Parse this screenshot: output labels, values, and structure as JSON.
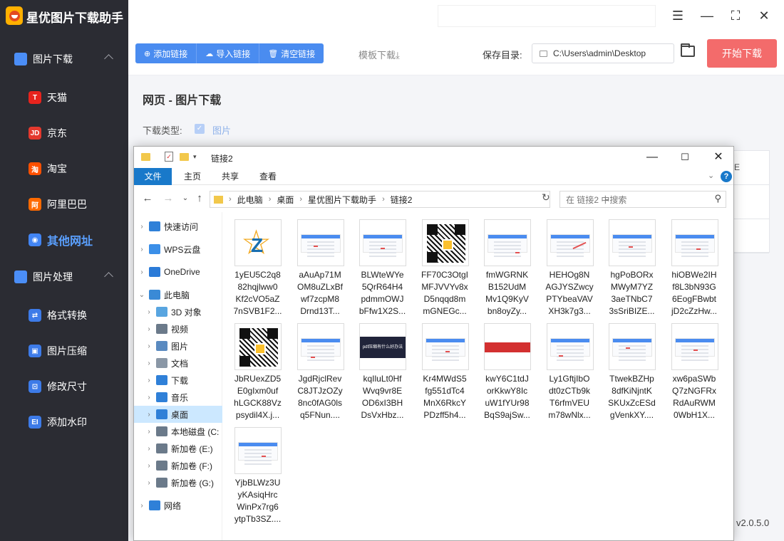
{
  "app": {
    "title": "星优图片下载助手",
    "version": "v2.0.5.0"
  },
  "sidebar": {
    "sections": [
      {
        "label": "图片下载",
        "items": [
          {
            "label": "天猫",
            "icon": "T",
            "color": "#e8231d"
          },
          {
            "label": "京东",
            "icon": "JD",
            "color": "#e4392e"
          },
          {
            "label": "淘宝",
            "icon": "淘",
            "color": "#ff5000"
          },
          {
            "label": "阿里巴巴",
            "icon": "阿",
            "color": "#ff6a00"
          },
          {
            "label": "其他网址",
            "icon": "◉",
            "color": "#4285f4",
            "active": true
          }
        ]
      },
      {
        "label": "图片处理",
        "items": [
          {
            "label": "格式转换",
            "icon": "⇄",
            "color": "#3d7be8"
          },
          {
            "label": "图片压缩",
            "icon": "▣",
            "color": "#3d7be8"
          },
          {
            "label": "修改尺寸",
            "icon": "⊡",
            "color": "#3d7be8"
          },
          {
            "label": "添加水印",
            "icon": "EI",
            "color": "#3d7be8"
          }
        ]
      }
    ]
  },
  "toolbar": {
    "add_link": "添加链接",
    "import_link": "导入链接",
    "clear_link": "清空链接",
    "template_download": "模板下载⤓",
    "save_dir_label": "保存目录:",
    "save_dir_value": "C:\\Users\\admin\\Desktop",
    "start_button": "开始下载"
  },
  "main": {
    "page_title": "网页 - 图片下载",
    "download_type_label": "下载类型:",
    "download_type_value": "图片",
    "table_header_fragment": "E"
  },
  "explorer": {
    "title": "链接2",
    "ribbon_tabs": [
      "文件",
      "主页",
      "共享",
      "查看"
    ],
    "breadcrumb": [
      "此电脑",
      "桌面",
      "星优图片下载助手",
      "链接2"
    ],
    "search_placeholder": "在 链接2 中搜索",
    "nav_items": [
      {
        "label": "快速访问",
        "icon": "star",
        "color": "#2f80d8",
        "level": 0,
        "arrow": "›"
      },
      {
        "label": "WPS云盘",
        "icon": "cloud",
        "color": "#3b8fe8",
        "level": 0,
        "arrow": "›"
      },
      {
        "label": "OneDrive",
        "icon": "cloud",
        "color": "#2b7bd8",
        "level": 0,
        "arrow": "›"
      },
      {
        "label": "此电脑",
        "icon": "pc",
        "color": "#3a8ad6",
        "level": 0,
        "arrow": "⌄"
      },
      {
        "label": "3D 对象",
        "icon": "cube",
        "color": "#58a5e0",
        "level": 1,
        "arrow": "›"
      },
      {
        "label": "视频",
        "icon": "film",
        "color": "#6b7a8a",
        "level": 1,
        "arrow": "›"
      },
      {
        "label": "图片",
        "icon": "picture",
        "color": "#5a8ac0",
        "level": 1,
        "arrow": "›"
      },
      {
        "label": "文档",
        "icon": "doc",
        "color": "#8a97a6",
        "level": 1,
        "arrow": "›"
      },
      {
        "label": "下载",
        "icon": "download",
        "color": "#2f80d8",
        "level": 1,
        "arrow": "›"
      },
      {
        "label": "音乐",
        "icon": "music",
        "color": "#2f80d8",
        "level": 1,
        "arrow": "›"
      },
      {
        "label": "桌面",
        "icon": "desktop",
        "color": "#2f80d8",
        "level": 1,
        "arrow": "›",
        "selected": true
      },
      {
        "label": "本地磁盘 (C:",
        "icon": "drive",
        "color": "#6b7a8a",
        "level": 1,
        "arrow": "›"
      },
      {
        "label": "新加卷 (E:)",
        "icon": "drive",
        "color": "#6b7a8a",
        "level": 1,
        "arrow": "›"
      },
      {
        "label": "新加卷 (F:)",
        "icon": "drive",
        "color": "#6b7a8a",
        "level": 1,
        "arrow": "›"
      },
      {
        "label": "新加卷 (G:)",
        "icon": "drive",
        "color": "#6b7a8a",
        "level": 1,
        "arrow": "›"
      },
      {
        "label": "网络",
        "icon": "network",
        "color": "#2f80d8",
        "level": 0,
        "arrow": "›"
      }
    ],
    "files": [
      {
        "name": "1yEU5C2q8\n82hqjlww0\nKf2cVO5aZ\n7nSVB1F2...",
        "thumb": "logo"
      },
      {
        "name": "aAuAp71M\nOM8uZLxBf\nwf7zcpM8\nDrnd13T...",
        "thumb": "ui"
      },
      {
        "name": "BLWteWYe\n5QrR64H4\npdmmOWJ\nbFfw1X2S...",
        "thumb": "ui"
      },
      {
        "name": "FF70C3OtgI\nMFJVVYv8x\nD5nqqd8m\nmGNEGc...",
        "thumb": "qr"
      },
      {
        "name": "fmWGRNK\nB152UdM\nMv1Q9KyV\nbn8oyZy...",
        "thumb": "ui"
      },
      {
        "name": "HEHOg8N\nAGJYSZwcy\nPTYbeaVAV\nXH3k7g3...",
        "thumb": "ui-red"
      },
      {
        "name": "hgPoBORx\nMWyM7YZ\n3aeTNbC7\n3sSriBIZE...",
        "thumb": "ui"
      },
      {
        "name": "hiOBWe2IH\nf8L3bN93G\n6EogFBwbt\njD2cZzHw...",
        "thumb": "ui"
      },
      {
        "name": "JbRUexZD5\nE0gIxm0uf\nhLGCK88Vz\npsydil4X.j...",
        "thumb": "qr2"
      },
      {
        "name": "JgdRjclRev\nC8JTJzOZy\n8nc0fAG0ls\nq5FNun....",
        "thumb": "ui"
      },
      {
        "name": "kqIluLt0Hf\nWvq9vr8E\nOD6xI3BH\nDsVxHbz...",
        "thumb": "dark"
      },
      {
        "name": "Kr4MWdS5\nfg551dTc4\nMnX6RkcY\nPDzff5h4...",
        "thumb": "ui"
      },
      {
        "name": "kwY6C1tdJ\norKkwY8Ic\nuW1fYUr98\nBqS9ajSw...",
        "thumb": "red"
      },
      {
        "name": "Ly1GftjIbO\ndt0zCTb9k\nT6rfmVEU\nm78wNlx...",
        "thumb": "ui"
      },
      {
        "name": "TtwekBZHp\n8dfKiNjntK\nSKUxZcESd\ngVenkXY....",
        "thumb": "ui"
      },
      {
        "name": "xw6paSWb\nQ7zNGFRx\nRdAuRWM\n0WbH1X...",
        "thumb": "ui"
      },
      {
        "name": "YjbBLWz3U\nyKAsiqHrc\nWinPx7rg6\nytpTb3SZ....",
        "thumb": "ui"
      }
    ],
    "dark_banner_text": "pdf压缩有什么好办法"
  }
}
